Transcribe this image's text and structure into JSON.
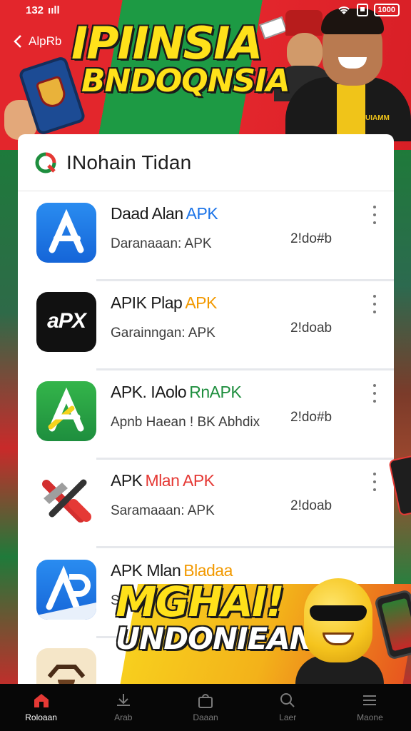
{
  "status_bar": {
    "time": "132",
    "signal": "ııll",
    "battery": "1000"
  },
  "header": {
    "back_label": "AlpRb",
    "banner_line1": "IPIINSIA",
    "banner_line2": "BNDOQNSIA",
    "badge_text": "UIAMM"
  },
  "card": {
    "title": "INohain Tidan",
    "items": [
      {
        "title_main": "Daad Alan",
        "title_highlight": "APK",
        "highlight_color": "#1a73e8",
        "subtitle": "Daranaaan: APK",
        "size": "2!do#b",
        "icon": "app-store-blue-icon"
      },
      {
        "title_main": "APIK Plap",
        "title_highlight": "APK",
        "highlight_color": "#f29900",
        "subtitle": "Garainngan: APK",
        "size": "2!doab",
        "icon": "apx-black-icon",
        "icon_text": "aPX"
      },
      {
        "title_main": "APK. IAolo",
        "title_highlight": "RnAPK",
        "highlight_color": "#1e8e3e",
        "subtitle": "Apnb Haean ! BK Abhdix",
        "size": "2!do#b",
        "icon": "app-store-green-icon"
      },
      {
        "title_main": "APK",
        "title_highlight": "Mlan APK",
        "highlight_color": "#e53935",
        "subtitle": "Saramaaan: APK",
        "size": "2!doab",
        "icon": "tools-red-icon"
      },
      {
        "title_main": "APK Mlan",
        "title_highlight": "Bladaa",
        "highlight_color": "#f29900",
        "subtitle": "Satal",
        "size": "",
        "icon": "app-store-blue-icon"
      }
    ]
  },
  "promo": {
    "line1": "MGHAI!",
    "line2": "UNDONIEAN"
  },
  "bottom_nav": [
    {
      "label": "Roloaan",
      "icon": "home-icon",
      "active": true
    },
    {
      "label": "Arab",
      "icon": "download-icon",
      "active": false
    },
    {
      "label": "Daaan",
      "icon": "bag-icon",
      "active": false
    },
    {
      "label": "Laer",
      "icon": "search-icon",
      "active": false
    },
    {
      "label": "Maone",
      "icon": "menu-icon",
      "active": false
    }
  ],
  "colors": {
    "red": "#e3262c",
    "green": "#1d9a44",
    "yellow": "#ffe11a",
    "nav_bg": "#070707"
  }
}
